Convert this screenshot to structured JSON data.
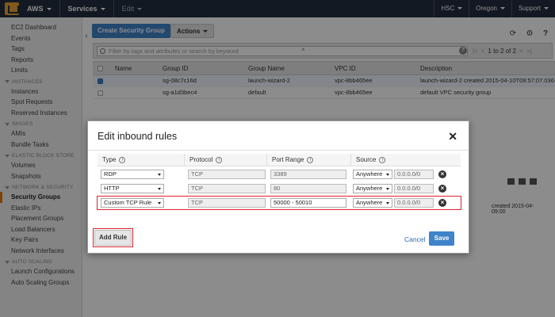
{
  "topnav": {
    "brand": "AWS",
    "services": "Services",
    "edit": "Edit",
    "user": "HSC",
    "region": "Oregon",
    "support": "Support"
  },
  "sidebar": {
    "top_links": [
      "EC2 Dashboard",
      "Events",
      "Tags",
      "Reports",
      "Limits"
    ],
    "sections": [
      {
        "title": "INSTANCES",
        "items": [
          "Instances",
          "Spot Requests",
          "Reserved Instances"
        ]
      },
      {
        "title": "IMAGES",
        "items": [
          "AMIs",
          "Bundle Tasks"
        ]
      },
      {
        "title": "ELASTIC BLOCK STORE",
        "items": [
          "Volumes",
          "Snapshots"
        ]
      },
      {
        "title": "NETWORK & SECURITY",
        "items": [
          "Security Groups",
          "Elastic IPs",
          "Placement Groups",
          "Load Balancers",
          "Key Pairs",
          "Network Interfaces"
        ]
      },
      {
        "title": "AUTO SCALING",
        "items": [
          "Launch Configurations",
          "Auto Scaling Groups"
        ]
      }
    ],
    "active": "Security Groups"
  },
  "toolbar": {
    "create_label": "Create Security Group",
    "actions_label": "Actions"
  },
  "filter": {
    "placeholder": "Filter by tags and attributes or search by keyword",
    "pager": "1 to 2 of 2"
  },
  "table": {
    "columns": [
      "Name",
      "Group ID",
      "Group Name",
      "VPC ID",
      "Description"
    ],
    "rows": [
      {
        "name": "",
        "group_id": "sg-08c7c16d",
        "group_name": "launch-wizard-2",
        "vpc_id": "vpc-8bb465ee",
        "description": "launch-wizard-2 created 2015-04-10T09:57:07.036+09",
        "selected": true
      },
      {
        "name": "",
        "group_id": "sg-a1d3bec4",
        "group_name": "default",
        "vpc_id": "vpc-8bb465ee",
        "description": "default VPC security group",
        "selected": false
      }
    ]
  },
  "details": {
    "line1": "created 2015-04-",
    "line2": "09:00"
  },
  "modal": {
    "title": "Edit inbound rules",
    "columns": {
      "type": "Type",
      "protocol": "Protocol",
      "port_range": "Port Range",
      "source": "Source"
    },
    "rules": [
      {
        "type": "RDP",
        "protocol": "TCP",
        "port_range": "3389",
        "source": "Anywhere",
        "cidr": "0.0.0.0/0",
        "highlighted": false
      },
      {
        "type": "HTTP",
        "protocol": "TCP",
        "port_range": "80",
        "source": "Anywhere",
        "cidr": "0.0.0.0/0",
        "highlighted": false
      },
      {
        "type": "Custom TCP Rule",
        "protocol": "TCP",
        "port_range": "50000 - 50010",
        "source": "Anywhere",
        "cidr": "0.0.0.0/0",
        "highlighted": true
      }
    ],
    "add_rule_label": "Add Rule",
    "cancel_label": "Cancel",
    "save_label": "Save"
  },
  "colors": {
    "nav_bg": "#232f3e",
    "primary": "#3f83c9",
    "highlight": "#d9232d",
    "accent": "#e47911"
  }
}
